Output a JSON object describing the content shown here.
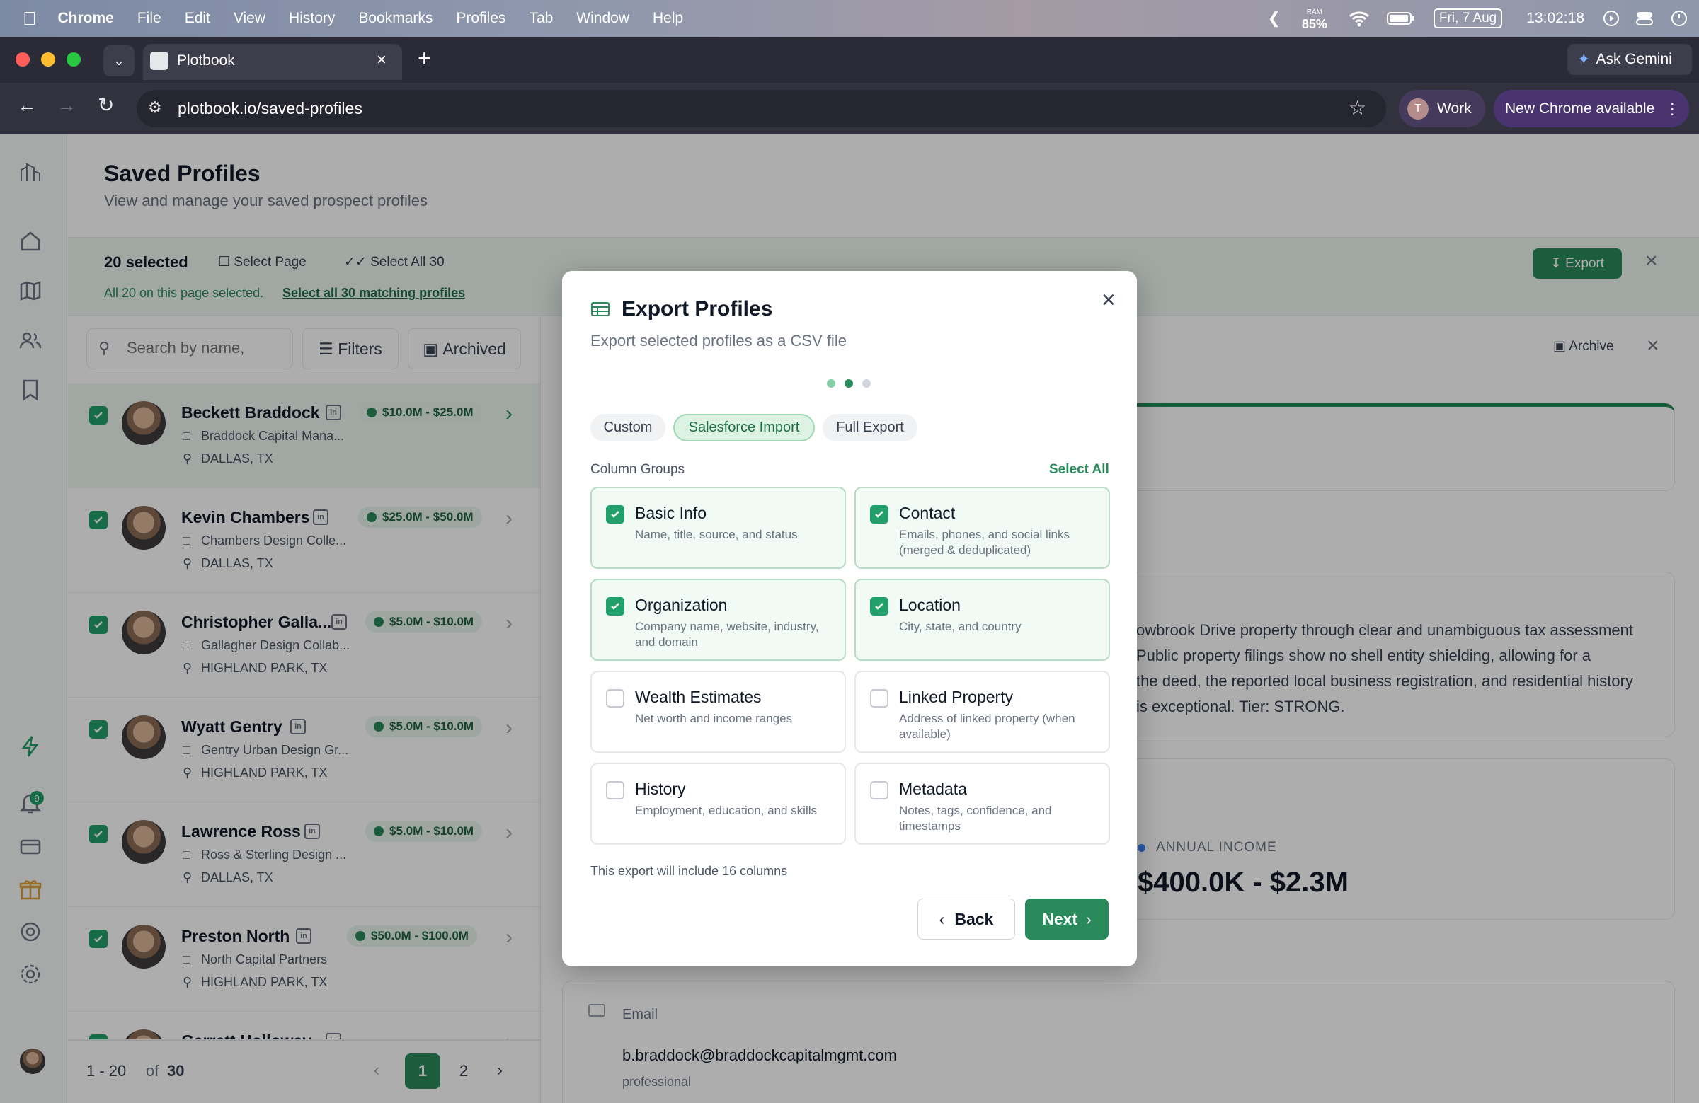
{
  "menubar": {
    "app": "Chrome",
    "items": [
      "File",
      "Edit",
      "View",
      "History",
      "Bookmarks",
      "Profiles",
      "Tab",
      "Window",
      "Help"
    ],
    "ram_label": "RAM",
    "ram_value": "85%",
    "date": "Fri, 7 Aug",
    "time": "13:02:18"
  },
  "browser": {
    "tab_title": "Plotbook",
    "url": "plotbook.io/saved-profiles",
    "profile_initial": "T",
    "profile_name": "Work",
    "update_label": "New Chrome available",
    "gemini_label": "Ask Gemini"
  },
  "page": {
    "title": "Saved Profiles",
    "subtitle": "View and manage your saved prospect profiles"
  },
  "selection": {
    "count": "20 selected",
    "select_page": "Select Page",
    "select_all": "Select All 30",
    "note": "All 20 on this page selected.",
    "note_link": "Select all 30 matching profiles",
    "export": "Export"
  },
  "list": {
    "search_placeholder": "Search by name,",
    "filters": "Filters",
    "archived": "Archived",
    "profiles": [
      {
        "name": "Beckett Braddock",
        "range": "$10.0M - $25.0M",
        "company": "Braddock Capital Mana...",
        "location": "DALLAS, TX"
      },
      {
        "name": "Kevin Chambers",
        "range": "$25.0M - $50.0M",
        "company": "Chambers Design Colle...",
        "location": "DALLAS, TX"
      },
      {
        "name": "Christopher Galla...",
        "range": "$5.0M - $10.0M",
        "company": "Gallagher Design Collab...",
        "location": "HIGHLAND PARK, TX"
      },
      {
        "name": "Wyatt Gentry",
        "range": "$5.0M - $10.0M",
        "company": "Gentry Urban Design Gr...",
        "location": "HIGHLAND PARK, TX"
      },
      {
        "name": "Lawrence Ross",
        "range": "$5.0M - $10.0M",
        "company": "Ross & Sterling Design ...",
        "location": "DALLAS, TX"
      },
      {
        "name": "Preston North",
        "range": "$50.0M - $100.0M",
        "company": "North Capital Partners",
        "location": "HIGHLAND PARK, TX"
      },
      {
        "name": "Garrett Holloway",
        "range": "",
        "company": "",
        "location": ""
      }
    ],
    "pagination": {
      "range": "1 - 20",
      "of": "of",
      "total": "30",
      "pages": [
        "1",
        "2"
      ]
    }
  },
  "detail": {
    "archive": "Archive",
    "summary_lines": [
      "owbrook Drive property through clear and unambiguous tax assessment",
      "Public property filings show no shell entity shielding, allowing for a",
      "the deed, the reported local business registration, and residential history",
      "is exceptional. Tier: STRONG."
    ],
    "income_label": "ANNUAL INCOME",
    "income_value": "$400.0K - $2.3M",
    "email_label": "Email",
    "email_value": "b.braddock@braddockcapitalmgmt.com",
    "email_type": "professional"
  },
  "modal": {
    "title": "Export Profiles",
    "subtitle": "Export selected profiles as a CSV file",
    "step": 2,
    "steps": 3,
    "presets": [
      "Custom",
      "Salesforce Import",
      "Full Export"
    ],
    "active_preset": "Salesforce Import",
    "groups_label": "Column Groups",
    "select_all": "Select All",
    "groups": [
      {
        "title": "Basic Info",
        "desc": "Name, title, source, and status",
        "checked": true
      },
      {
        "title": "Contact",
        "desc": "Emails, phones, and social links (merged & deduplicated)",
        "checked": true
      },
      {
        "title": "Organization",
        "desc": "Company name, website, industry, and domain",
        "checked": true
      },
      {
        "title": "Location",
        "desc": "City, state, and country",
        "checked": true
      },
      {
        "title": "Wealth Estimates",
        "desc": "Net worth and income ranges",
        "checked": false
      },
      {
        "title": "Linked Property",
        "desc": "Address of linked property (when available)",
        "checked": false
      },
      {
        "title": "History",
        "desc": "Employment, education, and skills",
        "checked": false
      },
      {
        "title": "Metadata",
        "desc": "Notes, tags, confidence, and timestamps",
        "checked": false
      }
    ],
    "footer_note": "This export will include 16 columns",
    "back": "Back",
    "next": "Next"
  },
  "notifications_count": "9",
  "colors": {
    "accent": "#2a8a5c",
    "check": "#22a06b",
    "tab_bar": "#2b2b38",
    "update_pill": "#4a3470"
  }
}
